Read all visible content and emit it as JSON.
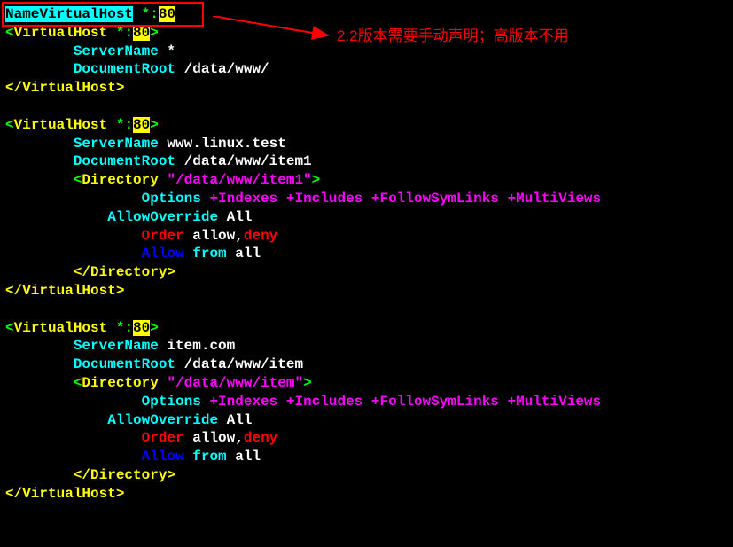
{
  "annotation": "2.2版本需要手动声明；高版本不用",
  "l1": {
    "directive": "NameVirtualHost",
    "star": " *:",
    "port": "80"
  },
  "vh1": {
    "open_lt": "<",
    "tag": "VirtualHost",
    "star": " *:",
    "port": "80",
    "open_gt": ">",
    "sn_label": "        ServerName",
    "sn_val": " *",
    "dr_label": "        DocumentRoot",
    "dr_val": " /data/www/",
    "close": "</VirtualHost>"
  },
  "vh2": {
    "open_lt": "<",
    "tag": "VirtualHost",
    "star": " *:",
    "port": "80",
    "open_gt": ">",
    "sn_label": "        ServerName",
    "sn_val": " www.linux.test",
    "dr_label": "        DocumentRoot",
    "dr_val": " /data/www/item1",
    "dir_lt": "        <",
    "dir_tag": "Directory",
    "dir_path": " \"/data/www/item1\"",
    "dir_gt": ">",
    "opt_label": "                Options",
    "opt_val": " +Indexes +Includes +FollowSymLinks +MultiViews",
    "ao_label": "            AllowOverride",
    "ao_val": " All",
    "ord_label": "                Order",
    "ord_val": " allow,",
    "ord_deny": "deny",
    "al_label": "                Allow",
    "al_from": " from",
    "al_all": " all",
    "dir_close": "        </Directory>",
    "close": "</VirtualHost>"
  },
  "vh3": {
    "open_lt": "<",
    "tag": "VirtualHost",
    "star": " *:",
    "port": "80",
    "open_gt": ">",
    "sn_label": "        ServerName",
    "sn_val": " item.com",
    "dr_label": "        DocumentRoot",
    "dr_val": " /data/www/item",
    "dir_lt": "        <",
    "dir_tag": "Directory",
    "dir_path": " \"/data/www/item\"",
    "dir_gt": ">",
    "opt_label": "                Options",
    "opt_val": " +Indexes +Includes +FollowSymLinks +MultiViews",
    "ao_label": "            AllowOverride",
    "ao_val": " All",
    "ord_label": "                Order",
    "ord_val": " allow,",
    "ord_deny": "deny",
    "al_label": "                Allow",
    "al_from": " from",
    "al_all": " all",
    "dir_close": "        </Directory>",
    "close": "</VirtualHost>"
  }
}
